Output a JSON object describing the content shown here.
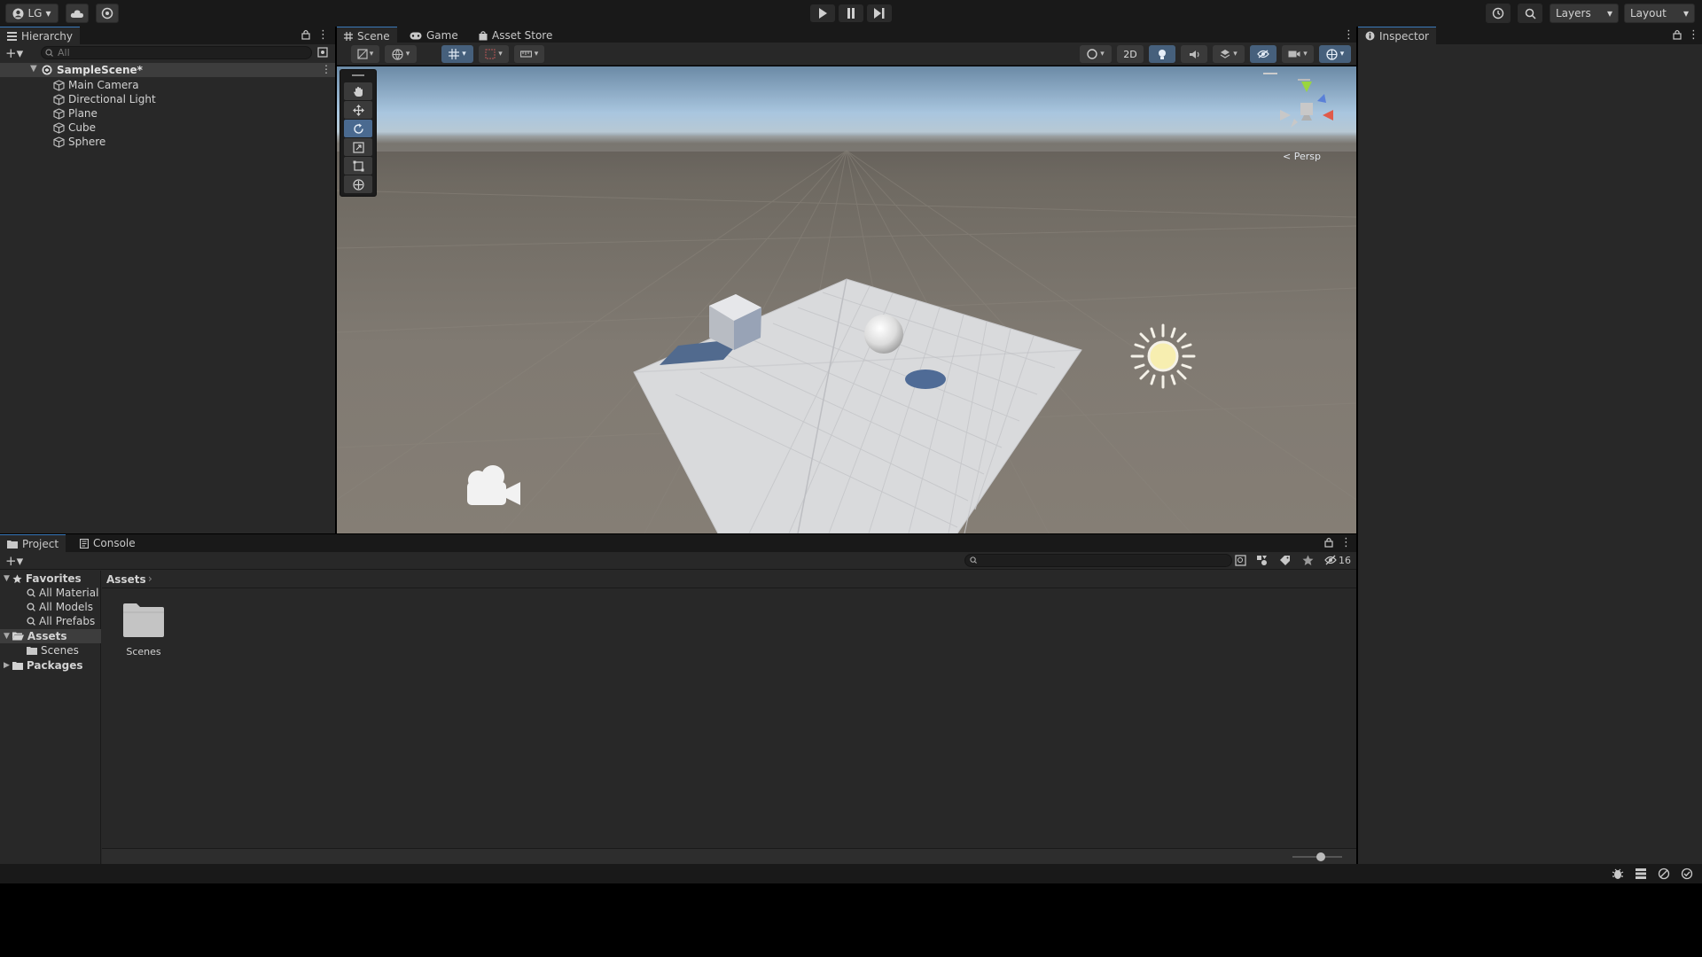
{
  "toolbar": {
    "account": "LG",
    "layers_label": "Layers",
    "layout_label": "Layout"
  },
  "hierarchy": {
    "tab": "Hierarchy",
    "search_placeholder": "All",
    "scene_name": "SampleScene*",
    "items": [
      {
        "label": "Main Camera"
      },
      {
        "label": "Directional Light"
      },
      {
        "label": "Plane"
      },
      {
        "label": "Cube"
      },
      {
        "label": "Sphere"
      }
    ]
  },
  "center_tabs": {
    "scene": "Scene",
    "game": "Game",
    "asset_store": "Asset Store"
  },
  "scene_toolbar": {
    "btn_2d": "2D",
    "persp_label": "< Persp"
  },
  "inspector": {
    "tab": "Inspector"
  },
  "project": {
    "tab_project": "Project",
    "tab_console": "Console",
    "breadcrumb": "Assets",
    "hidden_count": "16",
    "tree": {
      "favorites": "Favorites",
      "fav_items": [
        "All Materials",
        "All Models",
        "All Prefabs"
      ],
      "assets": "Assets",
      "scenes": "Scenes",
      "packages": "Packages"
    },
    "grid_items": [
      {
        "label": "Scenes"
      }
    ]
  },
  "colors": {
    "accent": "#3a79bb",
    "panel_bg": "#282828",
    "bar_bg": "#191919"
  }
}
